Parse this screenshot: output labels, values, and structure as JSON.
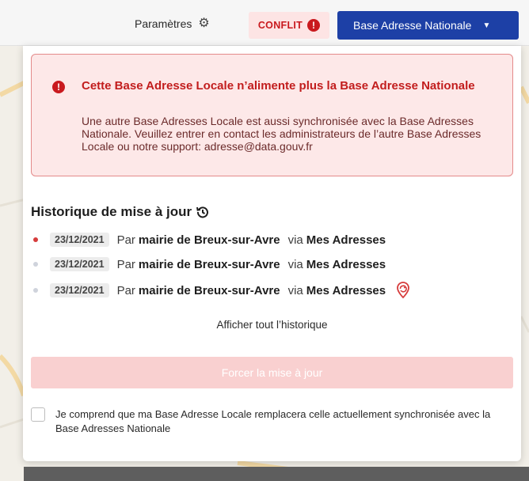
{
  "topbar": {
    "settings_label": "Paramètres",
    "conflict_label": "CONFLIT",
    "ban_button_label": "Base Adresse Nationale"
  },
  "alert": {
    "title": "Cette Base Adresse Locale n’alimente plus la Base Adresse Nationale",
    "body": "Une autre Base Adresses Locale est aussi synchronisée avec la Base Adresses Nationale. Veuillez entrer en contact les administrateurs de l’autre Base Adresses Locale ou notre support: adresse@data.gouv.fr"
  },
  "history": {
    "title": "Historique de mise à jour",
    "rows": [
      {
        "date": "23/12/2021",
        "by": "Par",
        "author": "mairie de Breux-sur-Avre",
        "via": "via",
        "source": "Mes Adresses",
        "status": "latest"
      },
      {
        "date": "23/12/2021",
        "by": "Par",
        "author": "mairie de Breux-sur-Avre",
        "via": "via",
        "source": "Mes Adresses",
        "status": "past"
      },
      {
        "date": "23/12/2021",
        "by": "Par",
        "author": "mairie de Breux-sur-Avre",
        "via": "via",
        "source": "Mes Adresses",
        "status": "past"
      }
    ],
    "show_all_label": "Afficher tout l’historique"
  },
  "actions": {
    "force_update_label": "Forcer la mise à jour",
    "confirm_checkbox_label": "Je comprend que ma Base Adresse Locale remplacera celle actuellement synchronisée avec la Base Adresses Nationale",
    "confirm_checked": false
  },
  "colors": {
    "accent": "#1d40a6",
    "danger": "#c9191e",
    "dot_active": "#d63c3c",
    "dot_inactive": "#cfd3dc"
  }
}
